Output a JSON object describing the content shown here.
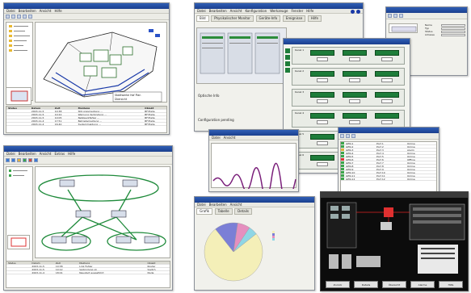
{
  "win1": {
    "title": "",
    "menu": [
      "Datei",
      "Bearbeiten",
      "Ansicht",
      "Hilfe"
    ],
    "map_label_1": "Stadtwerke Hof Plan",
    "map_label_2": "Übersicht",
    "events_header": [
      "Status",
      "Datum",
      "Zeit",
      "Meldung",
      "Objekt"
    ],
    "events": [
      [
        "",
        "2003-11-5",
        "10:38",
        "Störungsmeldung ...",
        "BF/Halle"
      ],
      [
        "",
        "2003-11-5",
        "10:22",
        "Warnung Verbindung ...",
        "BF/Halle"
      ],
      [
        "",
        "2003-11-5",
        "10:05",
        "Netzwerkfehler ...",
        "BF/Halle"
      ],
      [
        "",
        "2003-11-4",
        "17:51",
        "Betriebsmeldung ...",
        "BF/Halle"
      ],
      [
        "",
        "2003-11-4",
        "16:40",
        "Systemmeldung ...",
        "BF/Halle"
      ]
    ]
  },
  "win2": {
    "title": "",
    "menu": [
      "Datei",
      "Bearbeiten",
      "Ansicht",
      "Konfiguration",
      "Werkzeuge",
      "Fenster",
      "Hilfe"
    ],
    "tabs": [
      "Bild",
      "Physikalischer Monitor",
      "Geräte-Info",
      "Ereignisse",
      "Hilfe"
    ],
    "left_label": "Optische Info",
    "status": "Configuration pending"
  },
  "win3": {
    "title": "",
    "field_labels": [
      "Name",
      "Typ",
      "Status",
      "Adresse"
    ]
  },
  "win4": {
    "title": "",
    "channels": [
      "Kanal 1",
      "Kanal 2",
      "Kanal 3",
      "Kanal 4",
      "Kanal 5",
      "Kanal 6"
    ]
  },
  "win5": {
    "title": "",
    "menu": [
      "Datei",
      "Bearbeiten",
      "Ansicht",
      "Extras",
      "Hilfe"
    ],
    "events": [
      [
        "",
        "2003-11-5",
        "10:38",
        "Link Fehler",
        "Router"
      ],
      [
        "",
        "2003-11-5",
        "10:12",
        "Verbindung ok",
        "Switch"
      ],
      [
        "",
        "2003-11-4",
        "18:01",
        "Neustart ausgeführt",
        "Node"
      ]
    ]
  },
  "win6": {
    "title": "",
    "menu": [
      "Datei",
      "Ansicht"
    ]
  },
  "win7": {
    "title": "",
    "rows": [
      [
        "GEN-1",
        "Port 1",
        "Online",
        "ok"
      ],
      [
        "GEN-2",
        "Port 2",
        "Online",
        "ok"
      ],
      [
        "GEN-3",
        "Port 3",
        "Alarm",
        "warn"
      ],
      [
        "GEN-4",
        "Port 4",
        "Online",
        "ok"
      ],
      [
        "GEN-5",
        "Port 5",
        "Online",
        "ok"
      ],
      [
        "GEN-6",
        "Port 6",
        "Offline",
        "err"
      ],
      [
        "GEN-7",
        "Port 7",
        "Online",
        "ok"
      ],
      [
        "GEN-8",
        "Port 8",
        "Online",
        "ok"
      ],
      [
        "GEN-9",
        "Port 9",
        "Online",
        "ok"
      ],
      [
        "GEN-10",
        "Port 10",
        "Online",
        "ok"
      ],
      [
        "GEN-11",
        "Port 11",
        "Online",
        "ok"
      ],
      [
        "GEN-12",
        "Port 12",
        "Online",
        "ok"
      ]
    ]
  },
  "win8": {
    "title": "",
    "menu": [
      "Datei",
      "Bearbeiten",
      "Ansicht"
    ],
    "tabs": [
      "Grafik",
      "Tabelle",
      "Details"
    ],
    "legend": [
      {
        "label": "",
        "color": "#f4efb8"
      },
      {
        "label": "",
        "color": "#7b7fd6"
      },
      {
        "label": "",
        "color": "#e58fbf"
      },
      {
        "label": "",
        "color": "#8fd6e5"
      }
    ],
    "chart_data": {
      "type": "pie",
      "values": [
        75,
        13,
        7,
        5
      ],
      "title": ""
    }
  },
  "win9": {
    "title": "",
    "buttons": [
      "Zurück",
      "Details",
      "Übersicht",
      "Alarme",
      "Hilfe"
    ]
  },
  "colors": {
    "title_blue": "#1b3f8d",
    "green_net": "#1e8a3a",
    "red_alarm": "#e03030"
  }
}
